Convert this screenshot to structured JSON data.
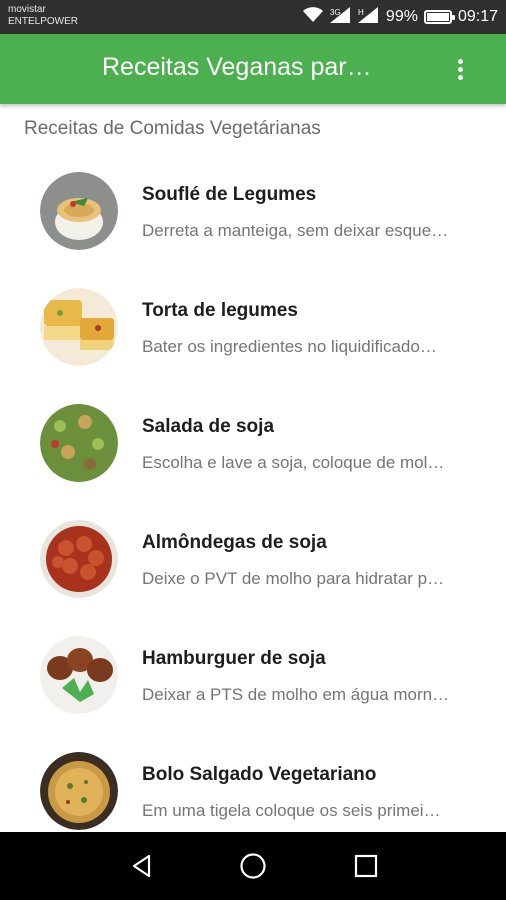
{
  "status_bar": {
    "carrier_line1": "movistar",
    "carrier_line2": "ENTELPOWER",
    "battery_percent": "99%",
    "battery_level": 0.99,
    "time": "09:17",
    "icons": [
      "wifi-icon",
      "signal-icon",
      "signal-icon",
      "battery-icon"
    ]
  },
  "app_bar": {
    "title": "Receitas Veganas par…",
    "menu_icon": "more-vert-icon",
    "color": "#4caf50"
  },
  "section_label": "Receitas de Comidas Vegetárianas",
  "recipes": [
    {
      "title": "Souflé de Legumes",
      "subtitle": "Derreta a manteiga, sem deixar esque…",
      "image": "souffle-thumbnail"
    },
    {
      "title": "Torta de legumes",
      "subtitle": "Bater os ingredientes no liquidificado…",
      "image": "veg-pie-thumbnail"
    },
    {
      "title": "Salada de soja",
      "subtitle": "Escolha e lave a soja, coloque de mol…",
      "image": "soy-salad-thumbnail"
    },
    {
      "title": "Almôndegas de soja",
      "subtitle": "Deixe o PVT de molho para hidratar p…",
      "image": "soy-meatballs-thumbnail"
    },
    {
      "title": "Hamburguer de soja",
      "subtitle": "Deixar a PTS de molho em água morn…",
      "image": "soy-burger-thumbnail"
    },
    {
      "title": "Bolo Salgado Vegetariano",
      "subtitle": "Em uma tigela coloque os seis primei…",
      "image": "savory-cake-thumbnail"
    }
  ],
  "nav_bar": {
    "icons": [
      "back-icon",
      "home-icon",
      "recents-icon"
    ]
  }
}
